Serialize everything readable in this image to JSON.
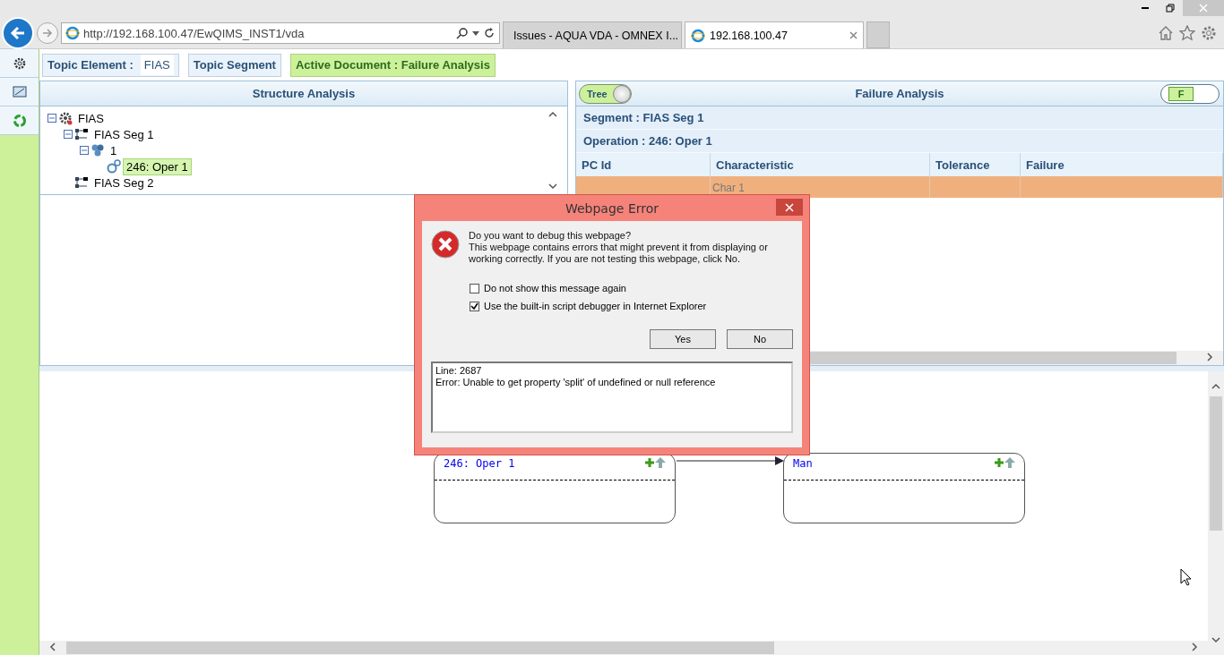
{
  "browser": {
    "address": "http://192.168.100.47/EwQIMS_INST1/vda",
    "tabs": [
      {
        "label": "Issues - AQUA VDA - OMNEX I...",
        "selected": false
      },
      {
        "label": "192.168.100.47",
        "selected": true
      }
    ]
  },
  "topic_bar": {
    "topic_element_label": "Topic Element :",
    "topic_element_value": "FIAS",
    "topic_segment_label": "Topic Segment",
    "active_document": "Active Document : Failure Analysis"
  },
  "structure_panel": {
    "title": "Structure Analysis",
    "tree": [
      {
        "label": "FIAS",
        "kind": "element",
        "expanded": true,
        "selected": false,
        "children": [
          {
            "label": "FIAS Seg 1",
            "kind": "segment",
            "expanded": true,
            "selected": false,
            "children": [
              {
                "label": "1",
                "kind": "group",
                "expanded": true,
                "selected": false,
                "children": [
                  {
                    "label": "246: Oper 1",
                    "kind": "operation",
                    "selected": true
                  }
                ]
              }
            ]
          },
          {
            "label": "FIAS Seg 2",
            "kind": "segment",
            "selected": false
          }
        ]
      }
    ]
  },
  "failure_panel": {
    "title": "Failure Analysis",
    "tree_toggle": {
      "label": "Tree",
      "on": true
    },
    "f_toggle": {
      "label": "F",
      "on": true
    },
    "segment": "Segment : FIAS Seg 1",
    "operation": "Operation : 246: Oper 1",
    "columns": [
      "PC Id",
      "Characteristic",
      "Tolerance",
      "Failure"
    ],
    "rows": [
      {
        "characteristic": "Char 1",
        "selected": true
      }
    ]
  },
  "diagram": {
    "nodes": [
      {
        "title": "246: Oper 1"
      },
      {
        "title": "Man"
      }
    ]
  },
  "dialog": {
    "title": "Webpage Error",
    "heading": "Do you want to debug this webpage?",
    "message": "This webpage contains errors that might prevent it from displaying or working correctly. If you are not testing this webpage, click No.",
    "options": [
      {
        "label": "Do not show this message again",
        "checked": false
      },
      {
        "label": "Use the built-in script debugger in Internet Explorer",
        "checked": true
      }
    ],
    "buttons": [
      "Yes",
      "No"
    ],
    "details": [
      "Line: 2687",
      "Error: Unable to get property 'split' of undefined or null reference"
    ]
  }
}
